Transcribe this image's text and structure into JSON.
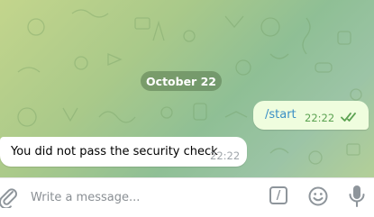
{
  "chat": {
    "date_separator": "October 22",
    "messages": [
      {
        "direction": "outgoing",
        "text": "/start",
        "time": "22:22",
        "status": "read"
      },
      {
        "direction": "incoming",
        "text": "You did not pass the security check",
        "time": "22:22"
      }
    ]
  },
  "composer": {
    "placeholder": "Write a message...",
    "command_label": "/"
  },
  "colors": {
    "outgoing_bubble": "#effdde",
    "outgoing_text_link": "#3a8fc5",
    "outgoing_time": "#5da353",
    "date_pill": "#6b8f5e",
    "icon_gray": "#8e959b"
  },
  "icons": {
    "attach": "paperclip-icon",
    "command": "slash-command-icon",
    "emoji": "emoji-icon",
    "voice": "microphone-icon",
    "read_receipt": "double-check-icon"
  }
}
